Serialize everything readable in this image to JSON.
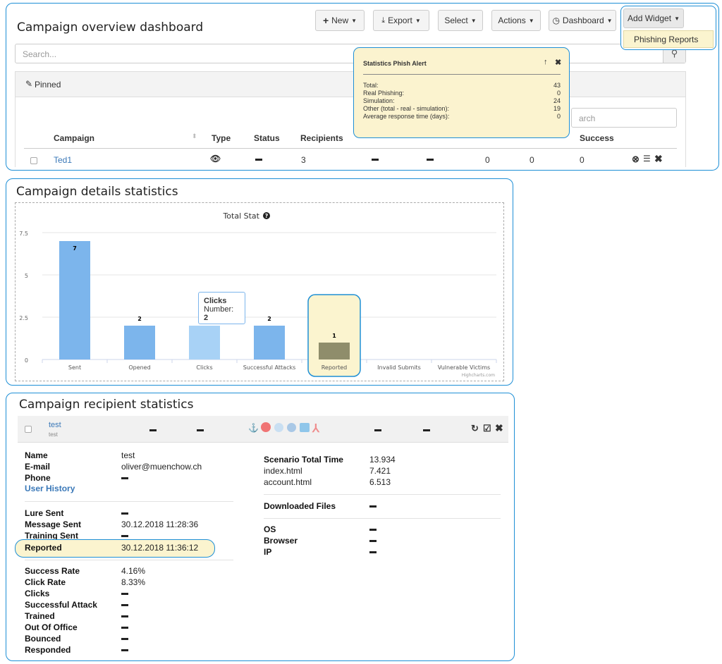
{
  "dashboard": {
    "title": "Campaign overview dashboard",
    "toolbar": {
      "new": "New",
      "export": "Export",
      "select": "Select",
      "actions": "Actions",
      "dashboard": "Dashboard",
      "add_widget": "Add Widget"
    },
    "dropdown_item": "Phishing Reports",
    "search_placeholder": "Search...",
    "pinned_label": "Pinned",
    "filter_placeholder": "arch",
    "columns": {
      "campaign": "Campaign",
      "type": "Type",
      "status": "Status",
      "recipients": "Recipients",
      "success": "Success"
    },
    "row": {
      "campaign": "Ted1",
      "recipients": "3",
      "c1": "0",
      "c2": "0",
      "success": "0"
    }
  },
  "phish_alert": {
    "title": "Statistics Phish Alert",
    "rows": [
      {
        "label": "Total:",
        "value": "43"
      },
      {
        "label": "Real Phishing:",
        "value": "0"
      },
      {
        "label": "Simulation:",
        "value": "24"
      },
      {
        "label": "Other (total - real - simulation):",
        "value": "19"
      },
      {
        "label": "Average response time (days):",
        "value": "0"
      }
    ]
  },
  "details": {
    "title": "Campaign details statistics",
    "credit": "Highcharts.com",
    "tooltip": {
      "title": "Clicks",
      "label": "Number:",
      "value": "2"
    }
  },
  "chart_data": {
    "type": "bar",
    "title": "Total Stat",
    "categories": [
      "Sent",
      "Opened",
      "Clicks",
      "Successful Attacks",
      "Reported",
      "Invalid Submits",
      "Vulnerable Victims"
    ],
    "values": [
      7,
      2,
      2,
      2,
      1,
      0,
      0
    ],
    "data_labels": [
      "7",
      "2",
      "2",
      "2",
      "1",
      "",
      ""
    ],
    "ylim": [
      0,
      7.5
    ],
    "yticks": [
      "0",
      "2.5",
      "5",
      "7.5"
    ],
    "grid": true,
    "colors": {
      "bar": "#7cb5ec",
      "hover": "#a8d2f6",
      "highlight": "#8f8d6b"
    }
  },
  "recipient": {
    "title": "Campaign recipient statistics",
    "header_name": "test",
    "header_sub": "test",
    "name_label": "Name",
    "name_value": "test",
    "email_label": "E-mail",
    "email_value": "oliver@muenchow.ch",
    "phone_label": "Phone",
    "user_history": "User History",
    "lure_label": "Lure Sent",
    "message_label": "Message Sent",
    "message_value": "30.12.2018 11:28:36",
    "training_label": "Training Sent",
    "reported_label": "Reported",
    "reported_value": "30.12.2018 11:36:12",
    "success_rate_label": "Success Rate",
    "success_rate_value": "4.16%",
    "click_rate_label": "Click Rate",
    "click_rate_value": "8.33%",
    "clicks_label": "Clicks",
    "attack_label": "Successful Attack",
    "trained_label": "Trained",
    "ooo_label": "Out Of Office",
    "bounced_label": "Bounced",
    "responded_label": "Responded",
    "scenario_label": "Scenario Total Time",
    "scenario_value": "13.934",
    "page1_label": "index.html",
    "page1_value": "7.421",
    "page2_label": "account.html",
    "page2_value": "6.513",
    "downloads_label": "Downloaded Files",
    "os_label": "OS",
    "browser_label": "Browser",
    "ip_label": "IP"
  }
}
